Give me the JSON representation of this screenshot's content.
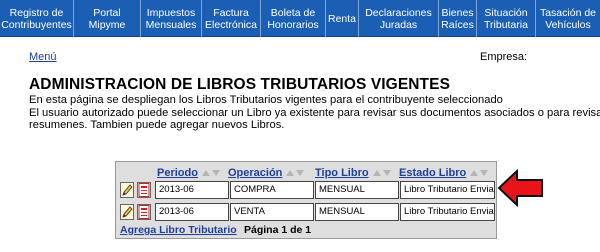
{
  "navbar": {
    "items": [
      {
        "label": "Registro de\nContribuyentes"
      },
      {
        "label": "Portal Mipyme"
      },
      {
        "label": "Impuestos\nMensuales"
      },
      {
        "label": "Factura\nElectrónica"
      },
      {
        "label": "Boleta de\nHonorarios"
      },
      {
        "label": "Renta"
      },
      {
        "label": "Declaraciones\nJuradas"
      },
      {
        "label": "Bienes\nRaíces"
      },
      {
        "label": "Situación\nTributaria"
      },
      {
        "label": "Tasación de\nVehículos"
      }
    ]
  },
  "menu_link": "Menú",
  "empresa_label": "Empresa:",
  "page_title": "ADMINISTRACION DE LIBROS TRIBUTARIOS VIGENTES",
  "description": {
    "line1": "En esta página se despliegan los Libros Tributarios vigentes para el contribuyente seleccionado",
    "line2": "El usuario autorizado puede seleccionar un Libro ya existente para revisar sus documentos asociados o para revisar sus",
    "line3": "resumenes. Tambien puede agregar nuevos Libros."
  },
  "table": {
    "headers": {
      "periodo": "Periodo",
      "operacion": "Operación",
      "tipo_libro": "Tipo Libro",
      "estado_libro": "Estado Libro"
    },
    "rows": [
      {
        "periodo": "2013-06",
        "operacion": "COMPRA",
        "tipo_libro": "MENSUAL",
        "estado_libro": "Libro Tributario Enviado"
      },
      {
        "periodo": "2013-06",
        "operacion": "VENTA",
        "tipo_libro": "MENSUAL",
        "estado_libro": "Libro Tributario Enviado"
      }
    ],
    "add_link": "Agrega Libro Tributario",
    "page_info": "Página 1 de 1"
  },
  "icons": {
    "edit": "pencil-edit-icon",
    "pdf": "pdf-document-icon",
    "annotation": "red-arrow-icon"
  },
  "colors": {
    "navbar": "#1a5fb4",
    "link": "#1f3f9a",
    "arrow": "#e8141a",
    "panel": "#dedede"
  }
}
